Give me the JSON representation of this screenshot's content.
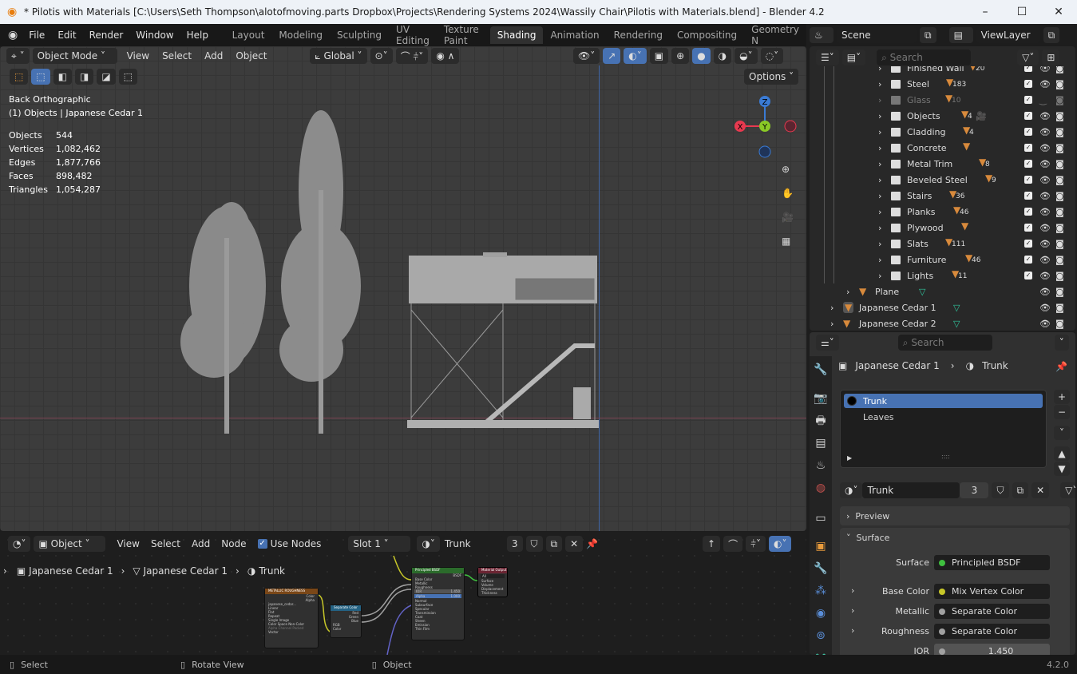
{
  "title_bar": {
    "title": "* Pilotis with Materials [C:\\Users\\Seth Thompson\\alotofmoving.parts Dropbox\\Projects\\Rendering Systems 2024\\Wassily Chair\\Pilotis with Materials.blend] - Blender 4.2",
    "minimize": "–",
    "maximize": "☐",
    "close": "✕"
  },
  "menu": [
    "File",
    "Edit",
    "Render",
    "Window",
    "Help"
  ],
  "workspaces": [
    "Layout",
    "Modeling",
    "Sculpting",
    "UV Editing",
    "Texture Paint",
    "Shading",
    "Animation",
    "Rendering",
    "Compositing",
    "Geometry N"
  ],
  "active_workspace": "Shading",
  "scene": {
    "name": "Scene",
    "view_layer": "ViewLayer"
  },
  "viewport": {
    "mode": "Object Mode",
    "menus": [
      "View",
      "Select",
      "Add",
      "Object"
    ],
    "transform": "Global",
    "options": "Options",
    "view_name": "Back Orthographic",
    "collection_info": "(1) Objects | Japanese Cedar 1",
    "stats": [
      {
        "label": "Objects",
        "value": "544"
      },
      {
        "label": "Vertices",
        "value": "1,082,462"
      },
      {
        "label": "Edges",
        "value": "1,877,766"
      },
      {
        "label": "Faces",
        "value": "898,482"
      },
      {
        "label": "Triangles",
        "value": "1,054,287"
      }
    ],
    "gizmo": {
      "z": "Z",
      "y": "Y",
      "x": "X"
    },
    "colors": {
      "x_axis": "#e8394f",
      "y_axis": "#8ac926",
      "z_axis": "#3a7bd5",
      "accent": "#4772b3"
    }
  },
  "node_editor": {
    "type": "Object",
    "menus": [
      "View",
      "Select",
      "Add",
      "Node"
    ],
    "use_nodes": "Use Nodes",
    "slot": "Slot 1",
    "material": "Trunk",
    "users": "3",
    "breadcrumb": [
      "Japanese Cedar 1",
      "Japanese Cedar 1",
      "Trunk"
    ],
    "nodes": {
      "image": {
        "title": "METALLIC ROUGHNESS",
        "outputs": [
          "Color",
          "Alpha"
        ],
        "image": "japanese_cedar...",
        "rows": [
          "Linear",
          "Flat",
          "Repeat",
          "Single Image"
        ],
        "color_space_label": "Color Space",
        "color_space": "Non-Color",
        "alpha_label": "Alpha",
        "alpha": "Channel Packed",
        "input": "Vector"
      },
      "separate": {
        "title": "Separate Color",
        "outputs": [
          "Red",
          "Green",
          "Blue"
        ],
        "mode": "RGB",
        "input": "Color"
      },
      "bsdf": {
        "title": "Principled BSDF",
        "output": "BSDF",
        "inputs": [
          "Base Color",
          "Metallic",
          "Roughness"
        ],
        "ior_label": "IOR",
        "ior": "1.450",
        "alpha_label": "Alpha",
        "alpha": "1.000",
        "more": [
          "Normal",
          "Subsurface",
          "Specular",
          "Transmission",
          "Coat",
          "Sheen",
          "Emission",
          "Thin Film"
        ]
      },
      "output": {
        "title": "Material Output",
        "target": "All",
        "inputs": [
          "Surface",
          "Volume",
          "Displacement",
          "Thickness"
        ]
      }
    }
  },
  "outliner": {
    "search_placeholder": "Search",
    "collections": [
      {
        "name": "Finished Wall",
        "count": "20"
      },
      {
        "name": "Steel",
        "count": "183"
      },
      {
        "name": "Glass",
        "count": "10",
        "disabled": true
      },
      {
        "name": "Objects",
        "count": "4"
      },
      {
        "name": "Cladding",
        "count": "4"
      },
      {
        "name": "Concrete",
        "count": ""
      },
      {
        "name": "Metal Trim",
        "count": "8"
      },
      {
        "name": "Beveled Steel",
        "count": "9"
      },
      {
        "name": "Stairs",
        "count": "36"
      },
      {
        "name": "Planks",
        "count": "46"
      },
      {
        "name": "Plywood",
        "count": ""
      },
      {
        "name": "Slats",
        "count": "111"
      },
      {
        "name": "Furniture",
        "count": "46"
      },
      {
        "name": "Lights",
        "count": "11"
      }
    ],
    "objects": [
      "Plane",
      "Japanese Cedar 1",
      "Japanese Cedar 2"
    ]
  },
  "properties": {
    "search_placeholder": "Search",
    "breadcrumb": [
      "Japanese Cedar 1",
      "Trunk"
    ],
    "slots": [
      "Trunk",
      "Leaves"
    ],
    "material": "Trunk",
    "users": "3",
    "panels": {
      "preview": "Preview",
      "surface": "Surface"
    },
    "fields": [
      {
        "label": "Surface",
        "value": "Principled BSDF",
        "color": "#3fbf3f"
      },
      {
        "label": "Base Color",
        "value": "Mix Vertex Color",
        "color": "#c7c729"
      },
      {
        "label": "Metallic",
        "value": "Separate Color",
        "color": "#a1a1a1"
      },
      {
        "label": "Roughness",
        "value": "Separate Color",
        "color": "#a1a1a1"
      },
      {
        "label": "IOR",
        "value": "1.450",
        "color": "#a1a1a1"
      }
    ]
  },
  "status_bar": {
    "select": "Select",
    "rotate": "Rotate View",
    "object": "Object",
    "version": "4.2.0"
  }
}
